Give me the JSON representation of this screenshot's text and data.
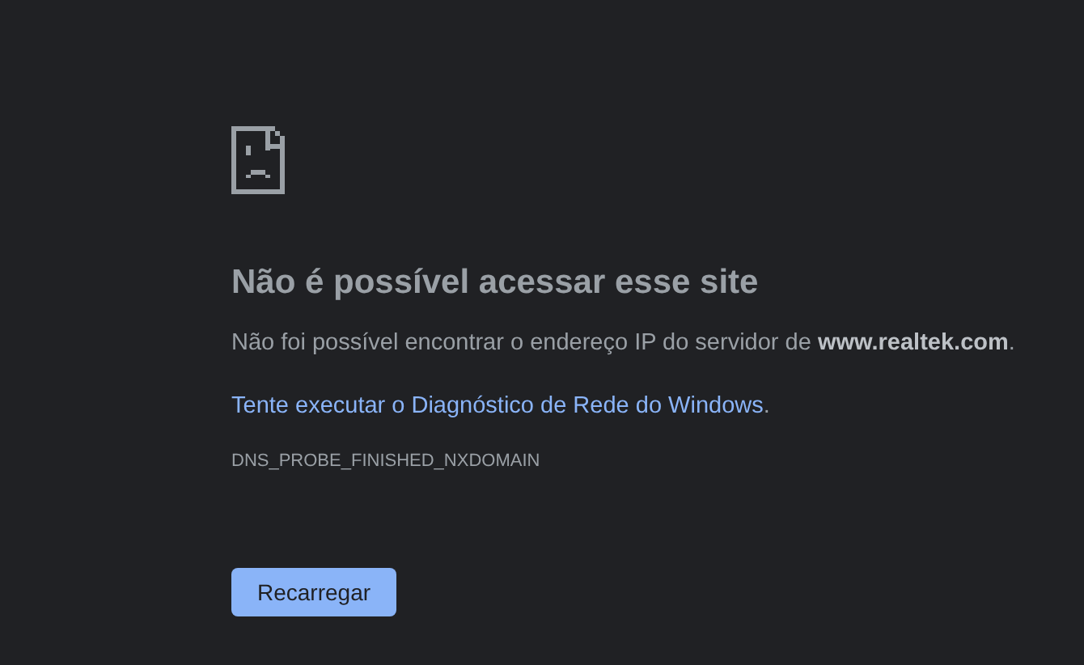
{
  "heading": "Não é possível acessar esse site",
  "message": "Não foi possível encontrar o endereço IP do servidor de **www.realtek.com**.",
  "suggestion": {
    "link": "Tente executar o Diagnóstico de Rede do Windows",
    "trailing": "."
  },
  "error_code": "DNS_PROBE_FINISHED_NXDOMAIN",
  "buttons": [
    {
      "label": "Recarregar"
    }
  ]
}
